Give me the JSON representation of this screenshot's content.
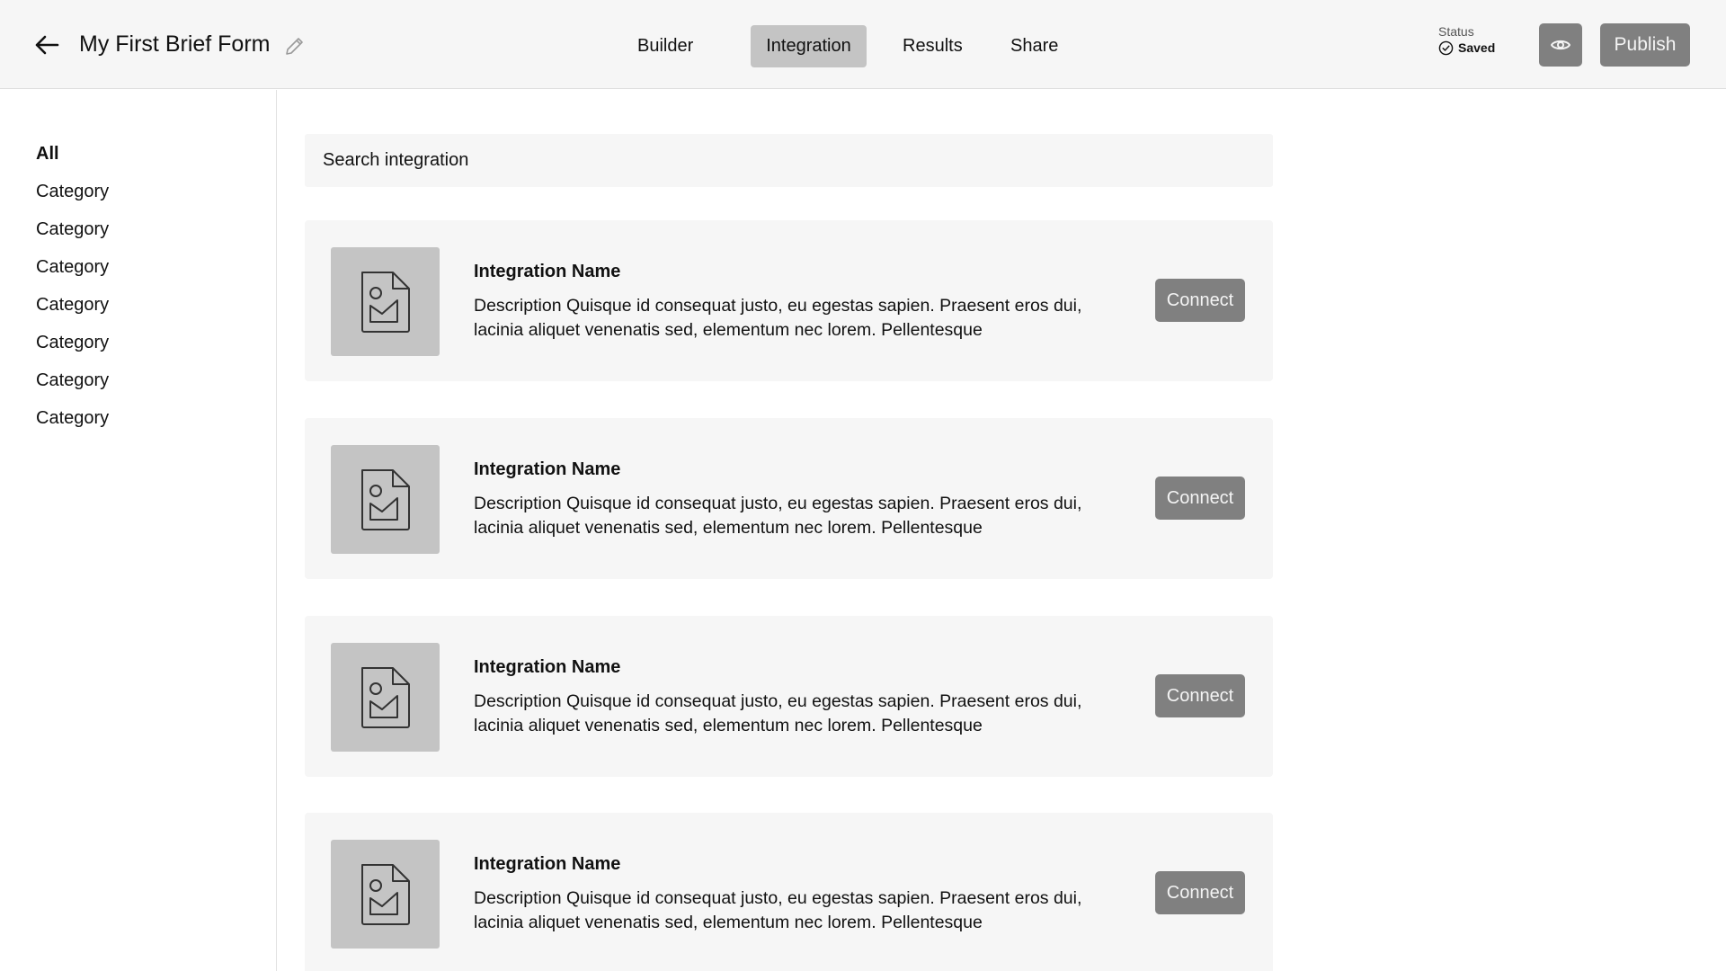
{
  "header": {
    "back_icon": "arrow-left-icon",
    "title": "My First Brief Form",
    "edit_icon": "pencil-icon",
    "tabs": [
      {
        "label": "Builder",
        "active": false
      },
      {
        "label": "Integration",
        "active": true
      },
      {
        "label": "Results",
        "active": false
      },
      {
        "label": "Share",
        "active": false
      }
    ],
    "status": {
      "label": "Status",
      "value": "Saved",
      "icon": "check-circle-icon"
    },
    "preview_icon": "eye-icon",
    "publish_label": "Publish"
  },
  "sidebar": {
    "categories": [
      {
        "label": "All",
        "active": true
      },
      {
        "label": "Category",
        "active": false
      },
      {
        "label": "Category",
        "active": false
      },
      {
        "label": "Category",
        "active": false
      },
      {
        "label": "Category",
        "active": false
      },
      {
        "label": "Category",
        "active": false
      },
      {
        "label": "Category",
        "active": false
      },
      {
        "label": "Category",
        "active": false
      }
    ]
  },
  "main": {
    "search": {
      "placeholder": "Search integration",
      "value": ""
    },
    "integrations": [
      {
        "icon": "image-file-icon",
        "name": "Integration Name",
        "description": "Description Quisque id consequat justo, eu egestas sapien. Praesent eros dui, lacinia aliquet venenatis sed, elementum nec lorem. Pellentesque",
        "action_label": "Connect"
      },
      {
        "icon": "image-file-icon",
        "name": "Integration Name",
        "description": "Description Quisque id consequat justo, eu egestas sapien. Praesent eros dui, lacinia aliquet venenatis sed, elementum nec lorem. Pellentesque",
        "action_label": "Connect"
      },
      {
        "icon": "image-file-icon",
        "name": "Integration Name",
        "description": "Description Quisque id consequat justo, eu egestas sapien. Praesent eros dui, lacinia aliquet venenatis sed, elementum nec lorem. Pellentesque",
        "action_label": "Connect"
      },
      {
        "icon": "image-file-icon",
        "name": "Integration Name",
        "description": "Description Quisque id consequat justo, eu egestas sapien. Praesent eros dui, lacinia aliquet venenatis sed, elementum nec lorem. Pellentesque",
        "action_label": "Connect"
      }
    ]
  },
  "colors": {
    "header_bg": "#f6f6f6",
    "active_tab_bg": "#c4c4c4",
    "button_bg": "#808080",
    "card_bg": "#f6f6f6",
    "thumb_bg": "#c4c4c4"
  }
}
